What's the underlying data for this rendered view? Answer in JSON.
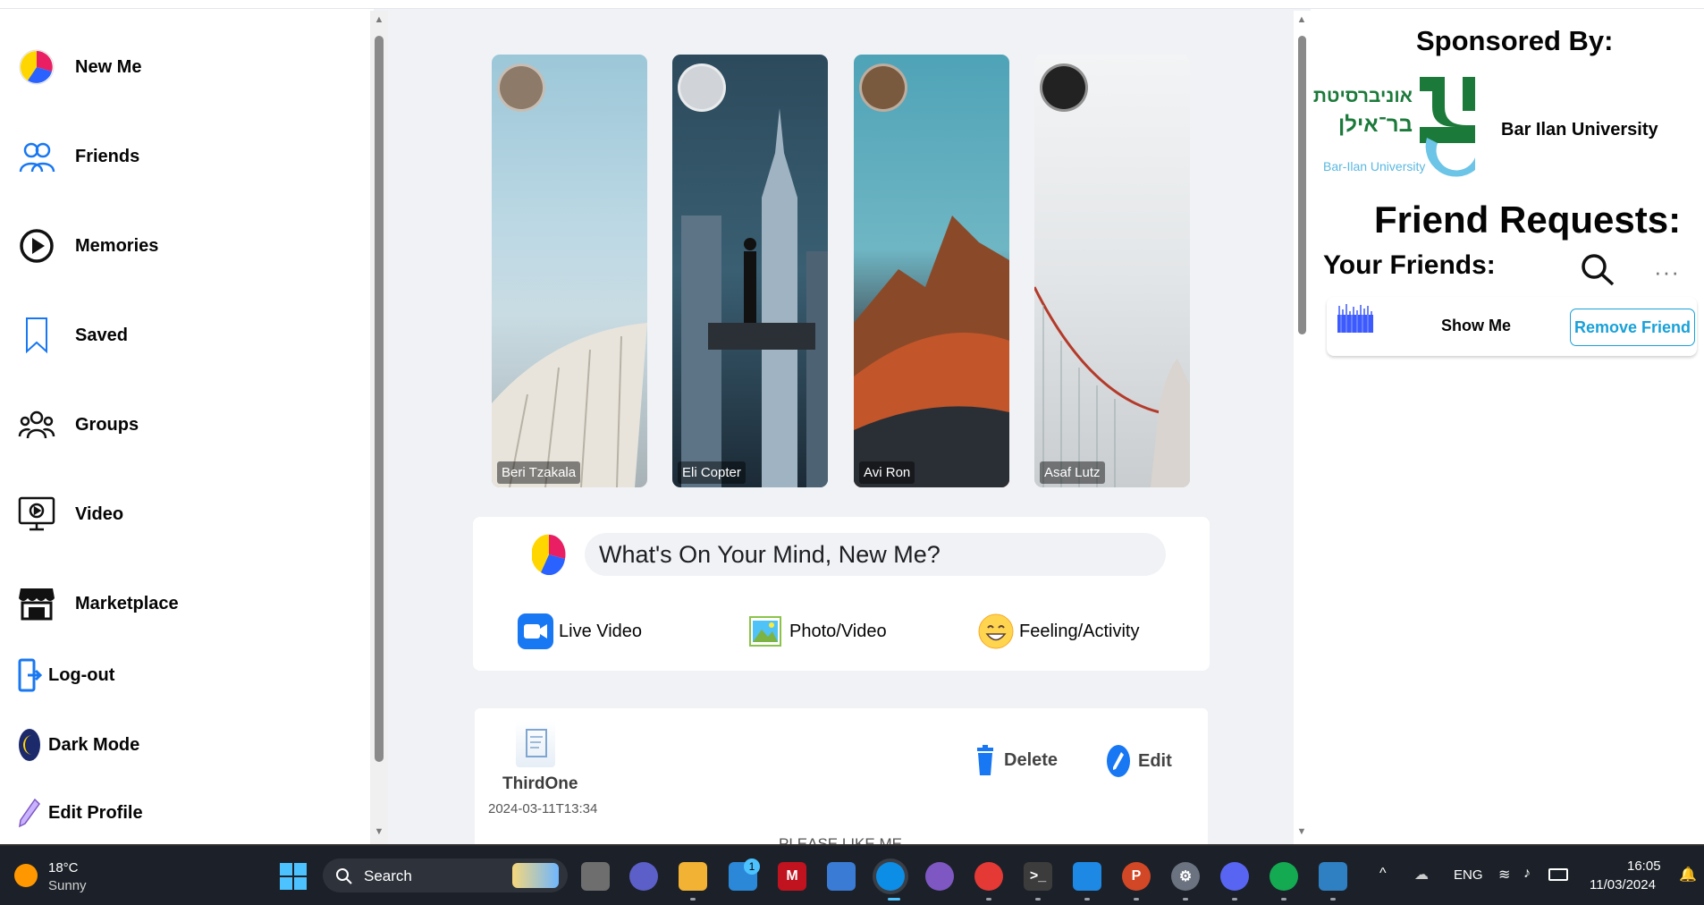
{
  "sidebar": {
    "items": [
      {
        "label": "New Me",
        "icon": "profile-icon"
      },
      {
        "label": "Friends",
        "icon": "friends-icon"
      },
      {
        "label": "Memories",
        "icon": "memories-icon"
      },
      {
        "label": "Saved",
        "icon": "bookmark-icon"
      },
      {
        "label": "Groups",
        "icon": "groups-icon"
      },
      {
        "label": "Video",
        "icon": "video-icon"
      },
      {
        "label": "Marketplace",
        "icon": "marketplace-icon"
      },
      {
        "label": "Log-out",
        "icon": "logout-icon"
      },
      {
        "label": "Dark Mode",
        "icon": "moon-icon"
      },
      {
        "label": "Edit Profile",
        "icon": "pencil-icon"
      }
    ]
  },
  "stories": [
    {
      "name": "Beri Tzakala"
    },
    {
      "name": "Eli Copter"
    },
    {
      "name": "Avi Ron"
    },
    {
      "name": "Asaf Lutz"
    }
  ],
  "composer": {
    "placeholder": "What's On Your Mind, New Me?",
    "actions": [
      {
        "label": "Live Video",
        "icon": "live-video-icon"
      },
      {
        "label": "Photo/Video",
        "icon": "photo-icon"
      },
      {
        "label": "Feeling/Activity",
        "icon": "smiley-icon"
      }
    ]
  },
  "post": {
    "author": "ThirdOne",
    "timestamp": "2024-03-11T13:34",
    "delete_label": "Delete",
    "edit_label": "Edit",
    "body_preview": "PLEASE LIKE ME"
  },
  "right": {
    "sponsored_heading": "Sponsored By:",
    "sponsor_name": "Bar Ilan University",
    "sponsor_logo_hebrew_line1": "אוניברסיטת",
    "sponsor_logo_hebrew_line2": "בר־אילן",
    "sponsor_logo_english": "Bar-Ilan University",
    "friend_requests_heading": "Friend Requests:",
    "your_friends_heading": "Your Friends:",
    "friend": {
      "name": "Show Me",
      "remove_label": "Remove Friend"
    }
  },
  "taskbar": {
    "weather_temp": "18°C",
    "weather_desc": "Sunny",
    "search_label": "Search",
    "store_badge": "1",
    "lang": "ENG",
    "time": "16:05",
    "date": "11/03/2024"
  },
  "colors": {
    "accent": "#19a1d8",
    "page_bg": "#f0f2f5",
    "taskbar_bg": "#1c2129"
  }
}
